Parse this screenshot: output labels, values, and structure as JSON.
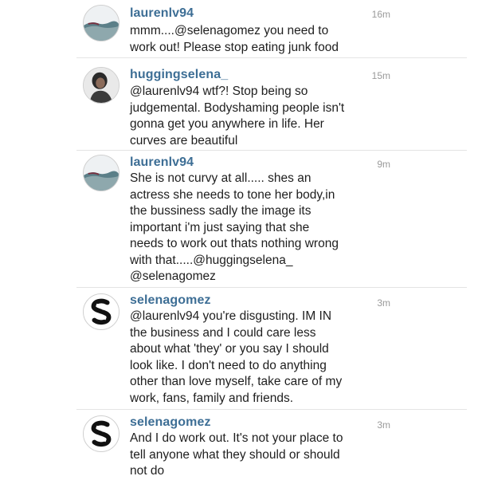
{
  "comments": [
    {
      "username": "laurenlv94",
      "time": "16m",
      "avatar": "landscape-avatar",
      "text": "mmm....@selenagomez you need to\nwork out! Please stop eating junk food"
    },
    {
      "username": "huggingselena_",
      "time": "15m",
      "avatar": "person-avatar",
      "text": "@laurenlv94 wtf?! Stop being so\njudgemental. Bodyshaming people isn't\ngonna get you anywhere in life. Her\ncurves are beautiful"
    },
    {
      "username": "laurenlv94",
      "time": "9m",
      "avatar": "landscape-avatar",
      "text": "She is not curvy at all..... shes an\nactress she needs to tone her body,in\nthe bussiness sadly the image its\nimportant i'm just saying that she\nneeds to work out thats nothing wrong\nwith that.....@huggingselena_\n@selenagomez"
    },
    {
      "username": "selenagomez",
      "time": "3m",
      "avatar": "s-logo-avatar",
      "text": "@laurenlv94 you're disgusting. IM IN\nthe business and I could care less\nabout what 'they' or you say I should\nlook like. I don't need to do anything\nother than love myself, take care of my\nwork, fans, family and friends."
    },
    {
      "username": "selenagomez",
      "time": "3m",
      "avatar": "s-logo-avatar",
      "text": "And I do work out. It's not your place to\ntell anyone what they should or should\nnot do"
    }
  ]
}
